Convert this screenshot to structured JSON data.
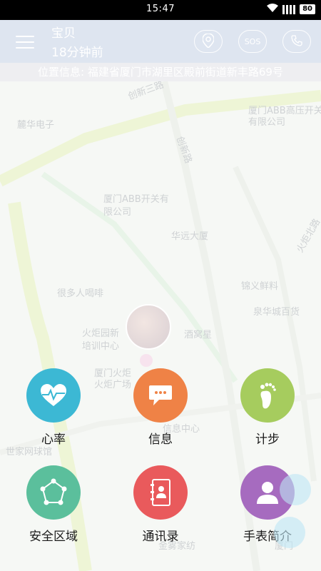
{
  "status_bar": {
    "time": "15:47",
    "battery": "80"
  },
  "header": {
    "child_name": "宝贝",
    "last_seen": "18分钟前",
    "sos_label": "SOS",
    "menu_icon": "hamburger-menu-icon",
    "location_icon": "location-pin-icon",
    "call_icon": "phone-icon"
  },
  "location_bar": {
    "text": "位置信息: 福建省厦门市湖里区殿前街道新丰路69号"
  },
  "map_labels": [
    "创新三路",
    "厦门ABB高压开关",
    "有限公司",
    "麓华电子",
    "创新路",
    "厦门ABB开关有",
    "限公司",
    "华远大厦",
    "火炬北路",
    "很多人喝啡",
    "锦义鲜料",
    "泉华城百货",
    "火炬园新",
    "培训中心",
    "酒窝星",
    "厦门火炬",
    "火炬广场",
    "信息中心",
    "世家网球馆",
    "金雾家纺",
    "厦门"
  ],
  "features": [
    {
      "label": "心率",
      "icon": "heart-rate-icon",
      "color": "#3cb8d4"
    },
    {
      "label": "信息",
      "icon": "message-icon",
      "color": "#ef8246"
    },
    {
      "label": "计步",
      "icon": "footprint-icon",
      "color": "#a6cc5e"
    },
    {
      "label": "安全区域",
      "icon": "safe-zone-icon",
      "color": "#5bbf9c"
    },
    {
      "label": "通讯录",
      "icon": "contacts-book-icon",
      "color": "#e95a5c"
    },
    {
      "label": "手表简介",
      "icon": "person-profile-icon",
      "color": "#a66bbf"
    }
  ]
}
